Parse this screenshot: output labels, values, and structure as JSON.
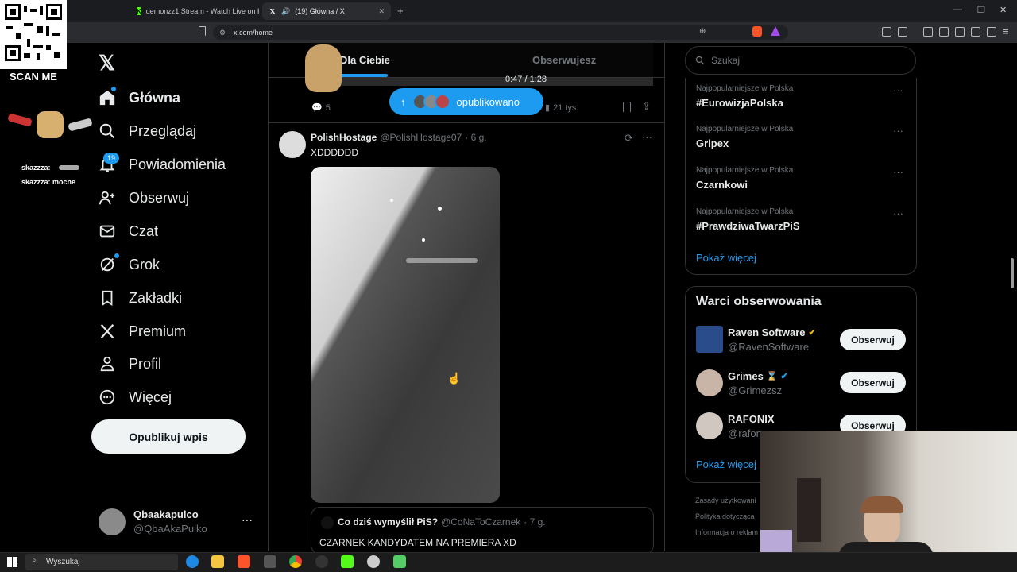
{
  "browser": {
    "tabs": [
      {
        "title": "demonzz1 Stream - Watch Live on K"
      },
      {
        "title": "(19) Główna / X"
      }
    ],
    "url": "x.com/home"
  },
  "overlay": {
    "scan_label": "SCAN ME",
    "chat": [
      {
        "user": "skazzza:",
        "text": ""
      },
      {
        "user": "skazzza:",
        "text": "mocne"
      }
    ]
  },
  "nav": {
    "items": [
      {
        "label": "Główna",
        "icon": "home-icon"
      },
      {
        "label": "Przeglądaj",
        "icon": "search-icon"
      },
      {
        "label": "Powiadomienia",
        "icon": "bell-icon",
        "badge": "19"
      },
      {
        "label": "Obserwuj",
        "icon": "follow-icon"
      },
      {
        "label": "Czat",
        "icon": "mail-icon"
      },
      {
        "label": "Grok",
        "icon": "grok-icon"
      },
      {
        "label": "Zakładki",
        "icon": "bookmark-icon"
      },
      {
        "label": "Premium",
        "icon": "x-logo-icon"
      },
      {
        "label": "Profil",
        "icon": "profile-icon"
      },
      {
        "label": "Więcej",
        "icon": "more-icon"
      }
    ],
    "post_button": "Opublikuj wpis",
    "account": {
      "name": "Qbaakapulco",
      "handle": "@QbaAkaPulko"
    }
  },
  "feed": {
    "tabs": [
      "Dla Ciebie",
      "Obserwujesz"
    ],
    "video_time": "0:47 / 1:28",
    "new_posts_label": "opublikowano",
    "prev_actions": {
      "replies": "5",
      "views": "21 tys."
    },
    "tweet": {
      "name": "PolishHostage",
      "handle": "@PolishHostage07",
      "time": "· 6 g.",
      "text": "XDDDDDD"
    },
    "quote": {
      "name": "Co dziś wymyślił PiS?",
      "handle": "@CoNaToCzarnek",
      "time": "· 7 g.",
      "text": "CZARNEK KANDYDATEM NA PREMIERA XD"
    }
  },
  "right": {
    "search_placeholder": "Szukaj",
    "trends": [
      {
        "category": "Najpopularniejsze w Polska",
        "name": "#EurowizjaPolska"
      },
      {
        "category": "Najpopularniejsze w Polska",
        "name": "Gripex"
      },
      {
        "category": "Najpopularniejsze w Polska",
        "name": "Czarnkowi"
      },
      {
        "category": "Najpopularniejsze w Polska",
        "name": "#PrawdziwaTwarzPiS"
      }
    ],
    "trends_more": "Pokaż więcej",
    "wtf_title": "Warci obserwowania",
    "wtf": [
      {
        "name": "Raven Software",
        "handle": "@RavenSoftware",
        "badge": "gold"
      },
      {
        "name": "Grimes",
        "handle": "@Grimezsz",
        "badge": "blue"
      },
      {
        "name": "RAFONIX",
        "handle": "@rafon",
        "badge": ""
      }
    ],
    "follow_label": "Obserwuj",
    "wtf_more": "Pokaż więcej",
    "footer": [
      "Zasady użytkowani",
      "Polityka dotycząca",
      "Informacja o reklam"
    ]
  },
  "taskbar": {
    "search_placeholder": "Wyszukaj"
  }
}
